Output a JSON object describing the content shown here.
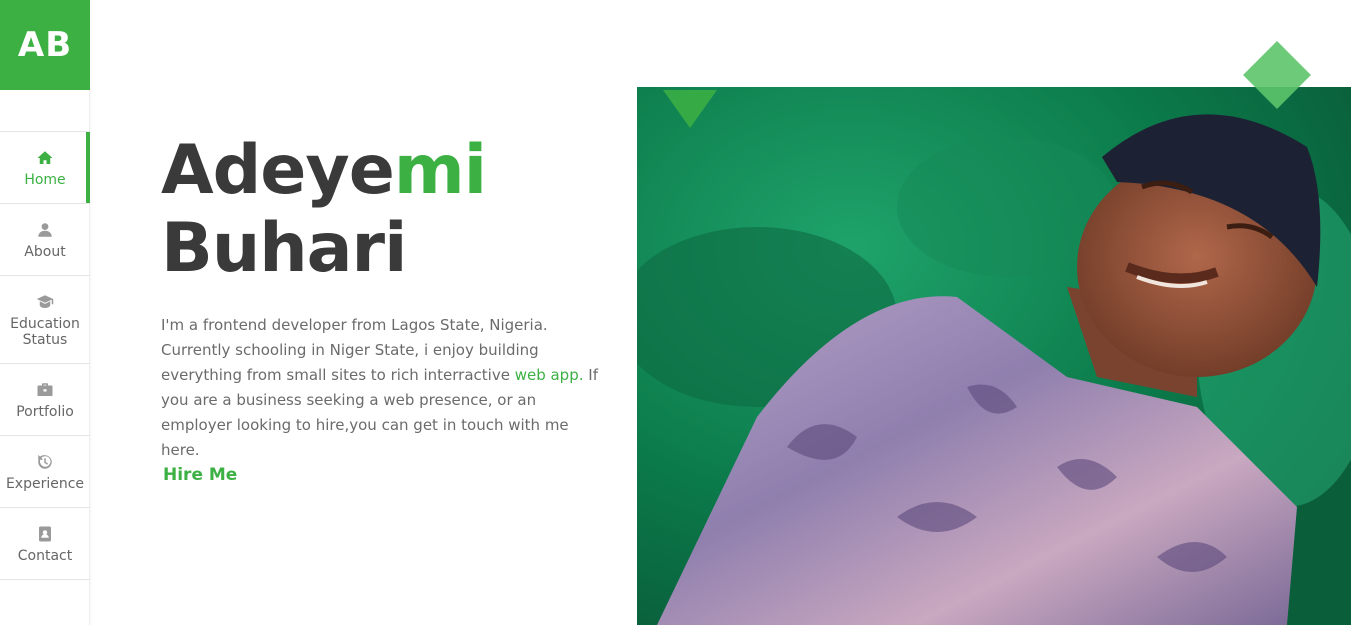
{
  "logo": {
    "text": "AB"
  },
  "nav": [
    {
      "label": "Home",
      "icon": "home-icon",
      "active": true
    },
    {
      "label": "About",
      "icon": "user-icon",
      "active": false
    },
    {
      "label": "Education\nStatus",
      "icon": "graduation-cap-icon",
      "active": false
    },
    {
      "label": "Portfolio",
      "icon": "briefcase-icon",
      "active": false
    },
    {
      "label": "Experience",
      "icon": "history-icon",
      "active": false
    },
    {
      "label": "Contact",
      "icon": "address-book-icon",
      "active": false
    }
  ],
  "hero": {
    "name_part1": "Adeye",
    "name_part2": "mi",
    "name_line2": "Buhari",
    "desc_before": "I'm a frontend developer from Lagos State, Nigeria. Currently schooling in Niger State, i enjoy building everything from small sites to rich interractive ",
    "desc_link": "web app.",
    "desc_after": " If you are a business seeking a web presence, or an employer looking to hire,you can get in touch with me here.",
    "cta": "Hire Me"
  },
  "colors": {
    "accent": "#3cb043",
    "text": "#3a3a3a",
    "muted": "#6b6b6b"
  }
}
